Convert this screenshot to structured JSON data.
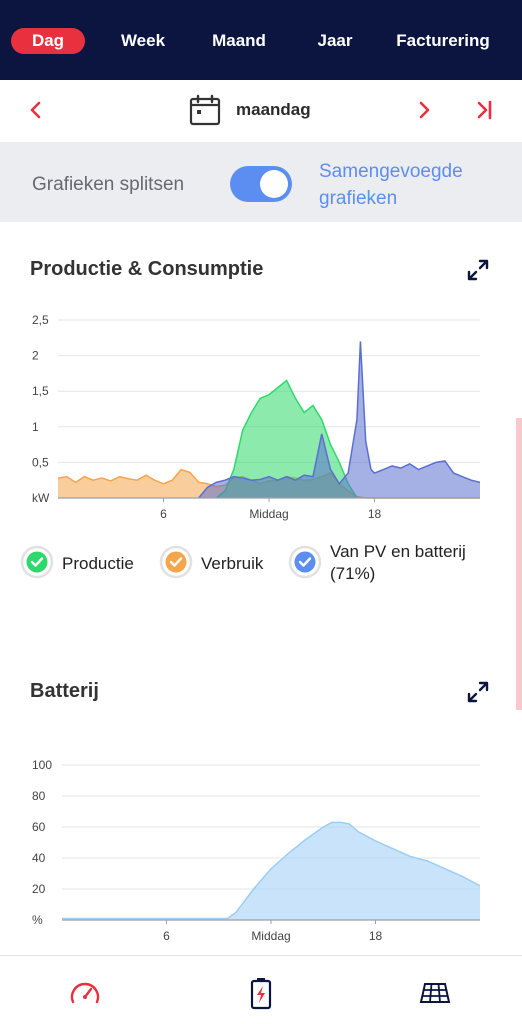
{
  "tabs": [
    {
      "label": "Dag",
      "active": true
    },
    {
      "label": "Week",
      "active": false
    },
    {
      "label": "Maand",
      "active": false
    },
    {
      "label": "Jaar",
      "active": false
    },
    {
      "label": "Facturering",
      "active": false
    }
  ],
  "date_nav": {
    "day": "maandag",
    "prev_icon": "chevron-left-icon",
    "next_icon": "chevron-right-icon",
    "last_icon": "skip-to-end-icon",
    "calendar_icon": "calendar-icon"
  },
  "split": {
    "label": "Grafieken splitsen",
    "toggle_on": true,
    "merged_label": "Samengevoegde grafieken"
  },
  "colors": {
    "header_bg": "#0b1540",
    "active_tab": "#e8303f",
    "accent_blue": "#5b8ef0",
    "production": "#2ed86a",
    "consumption": "#f5a54a",
    "pv_battery": "#5b6fd0",
    "battery": "#9ccdf6"
  },
  "production_section": {
    "title": "Productie & Consumptie"
  },
  "legend": [
    {
      "label": "Productie",
      "color": "#2ed86a",
      "icon": "check-circle-icon"
    },
    {
      "label": "Verbruik",
      "color": "#f5a54a",
      "icon": "check-circle-icon"
    },
    {
      "label": "Van PV en batterij (71%)",
      "color": "#5b8ef0",
      "icon": "check-circle-icon"
    }
  ],
  "battery_section": {
    "title": "Batterij"
  },
  "bottom_nav": [
    {
      "icon": "speedometer-icon"
    },
    {
      "icon": "battery-icon"
    },
    {
      "icon": "solar-panel-icon"
    }
  ],
  "chart_data": [
    {
      "type": "area",
      "title": "Productie & Consumptie",
      "ylabel": "kW",
      "xlim": [
        0,
        24
      ],
      "ylim": [
        0,
        2.5
      ],
      "yticks": [
        "2,5",
        "2",
        "1,5",
        "1",
        "0,5"
      ],
      "y_unit_label": "kW",
      "xticks": [
        {
          "x": 6,
          "label": "6"
        },
        {
          "x": 12,
          "label": "Middag"
        },
        {
          "x": 18,
          "label": "18"
        }
      ],
      "grid": true,
      "series": [
        {
          "name": "Verbruik",
          "color": "#f5a54a",
          "x": [
            0,
            0.5,
            1,
            1.5,
            2,
            2.5,
            3,
            3.5,
            4,
            4.5,
            5,
            5.5,
            6,
            6.5,
            7,
            7.5,
            8,
            8.5,
            9,
            9.5,
            10,
            10.5,
            11,
            11.5,
            12,
            12.5,
            13,
            13.5,
            14,
            14.5,
            15,
            15.5,
            16,
            16.5,
            17,
            17.5,
            18,
            18.5,
            19,
            19.5,
            20,
            20.5,
            21,
            21.5,
            22,
            22.5,
            23,
            23.5,
            24
          ],
          "values": [
            0.28,
            0.3,
            0.22,
            0.3,
            0.25,
            0.28,
            0.24,
            0.3,
            0.27,
            0.25,
            0.32,
            0.25,
            0.2,
            0.25,
            0.4,
            0.36,
            0.22,
            0.2,
            0.16,
            0.18,
            0.28,
            0.3,
            0.25,
            0.2,
            0.24,
            0.25,
            0.3,
            0.28,
            0.25,
            0.26,
            0.3,
            0.35,
            0.2,
            0.1,
            0.02,
            0.0,
            0.0,
            0.0,
            0.0,
            0.0,
            0.0,
            0.0,
            0.0,
            0.0,
            0.0,
            0.0,
            0.0,
            0.0,
            0.0
          ]
        },
        {
          "name": "Productie",
          "color": "#2ed86a",
          "x": [
            9,
            9.5,
            10,
            10.5,
            11,
            11.5,
            12,
            12.5,
            13,
            13.5,
            14,
            14.5,
            15,
            15.5,
            16,
            16.5,
            17
          ],
          "values": [
            0.0,
            0.1,
            0.4,
            0.95,
            1.2,
            1.4,
            1.45,
            1.55,
            1.65,
            1.4,
            1.2,
            1.3,
            1.1,
            0.75,
            0.5,
            0.2,
            0.0
          ]
        },
        {
          "name": "Van PV en batterij (71%)",
          "color": "#5b6fd0",
          "x": [
            8,
            8.5,
            9,
            9.5,
            10,
            10.5,
            11,
            11.5,
            12,
            12.5,
            13,
            13.5,
            14,
            14.5,
            15,
            15.5,
            16,
            16.5,
            17,
            17.2,
            17.5,
            17.8,
            18,
            18.5,
            19,
            19.5,
            20,
            20.5,
            21,
            21.5,
            22,
            22.5,
            23,
            23.5,
            24
          ],
          "values": [
            0.0,
            0.15,
            0.22,
            0.25,
            0.3,
            0.28,
            0.25,
            0.26,
            0.3,
            0.25,
            0.3,
            0.25,
            0.32,
            0.3,
            0.9,
            0.4,
            0.2,
            0.35,
            1.1,
            2.2,
            0.8,
            0.4,
            0.35,
            0.4,
            0.45,
            0.42,
            0.48,
            0.4,
            0.45,
            0.5,
            0.52,
            0.35,
            0.3,
            0.25,
            0.22
          ]
        }
      ]
    },
    {
      "type": "area",
      "title": "Batterij",
      "ylabel": "%",
      "xlim": [
        0,
        24
      ],
      "ylim": [
        0,
        100
      ],
      "yticks": [
        "100",
        "80",
        "60",
        "40",
        "20"
      ],
      "y_unit_label": "%",
      "xticks": [
        {
          "x": 6,
          "label": "6"
        },
        {
          "x": 12,
          "label": "Middag"
        },
        {
          "x": 18,
          "label": "18"
        }
      ],
      "grid": true,
      "series": [
        {
          "name": "Batterij",
          "color": "#9ccdf6",
          "x": [
            0,
            2,
            4,
            6,
            8,
            9.5,
            10,
            11,
            12,
            13,
            14,
            15,
            15.5,
            16,
            16.5,
            17,
            18,
            19,
            20,
            21,
            22,
            23,
            24
          ],
          "values": [
            1,
            1,
            1,
            1,
            1,
            1,
            5,
            20,
            33,
            43,
            52,
            60,
            63,
            63,
            62,
            57,
            51,
            46,
            41,
            38,
            33,
            28,
            22
          ]
        }
      ]
    }
  ]
}
